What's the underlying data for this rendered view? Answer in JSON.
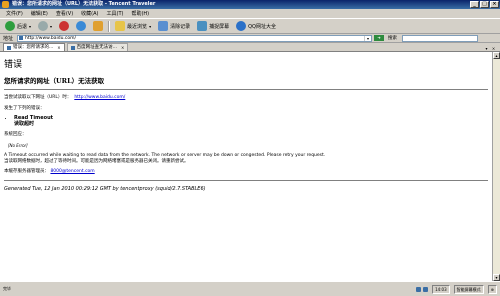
{
  "window": {
    "title": "错误：您所请求的网址（URL）无法获取 - Tencent Traveler"
  },
  "menu": [
    "文件(F)",
    "编辑(E)",
    "查看(V)",
    "收藏(A)",
    "工具(T)",
    "帮助(H)"
  ],
  "toolbar": {
    "back": "后退",
    "forward": "▸",
    "recent": "最近浏览",
    "clear": "清除记录",
    "capture": "捕捉屏幕",
    "qq": "QQ网址大全"
  },
  "address": {
    "label": "地址",
    "value": "http://www.baidu.com/",
    "search_label": "搜索"
  },
  "tabs": [
    {
      "label": "错误：您所请求的..."
    },
    {
      "label": "百度网址查无法访..."
    }
  ],
  "page": {
    "title": "错误",
    "subtitle": "您所请求的网址（URL）无法获取",
    "attempt_text": "当尝试读取以下网址（URL）时：",
    "url": "http://www.baidu.com/",
    "error_intro": "发生了下列的错误：",
    "error_name": "Read Timeout",
    "error_name_cn": "读取超时",
    "sysmsg_label": "系统回应：",
    "errno": "[No Error]",
    "desc_en": "A Timeout occurred while waiting to read data from the network. The network or server may be down or congested. Please retry your request.",
    "desc_cn": "当读取网络数据时，超过了等待时间。可能是因为网络堵塞或是服务器已关闭。请重新尝试。",
    "admin_label": "本缓存服务器管理员：",
    "admin_email": "8000@tencent.com",
    "footer": "Generated Tue, 12 Jan 2010 00:29:12 GMT by tencentproxy (squid/2.7.STABLE6)"
  },
  "status": {
    "left": "完毕",
    "time": "14:03",
    "mode": "智能屏幕模式"
  }
}
